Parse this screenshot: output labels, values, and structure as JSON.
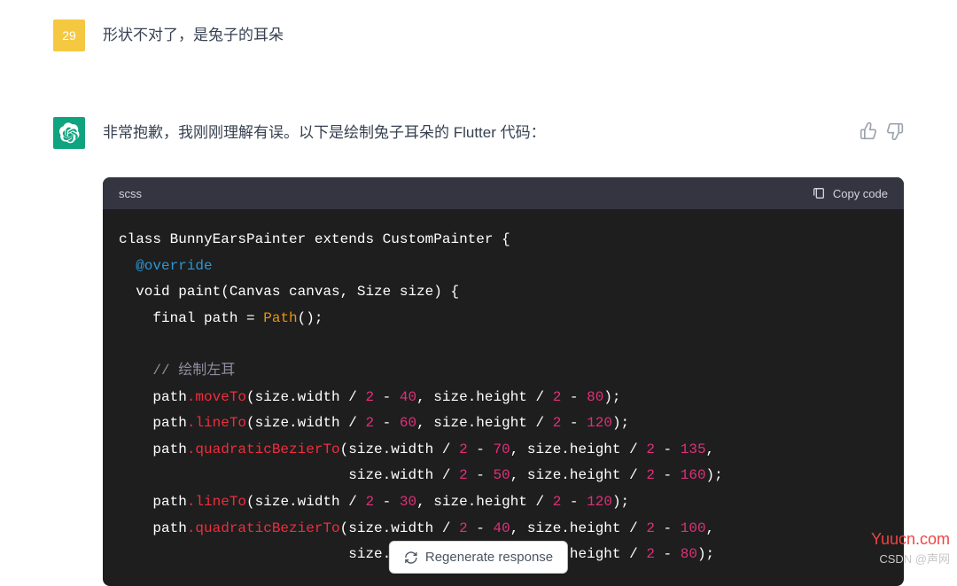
{
  "user": {
    "avatar_text": "29",
    "message": "形状不对了，是兔子的耳朵"
  },
  "assistant": {
    "message": "非常抱歉，我刚刚理解有误。以下是绘制兔子耳朵的 Flutter 代码："
  },
  "code": {
    "language": "scss",
    "copy_label": "Copy code",
    "lines": {
      "l1a": "class BunnyEarsPainter extends CustomPainter {",
      "l2a": "@override",
      "l3a": "void paint(Canvas canvas, Size size) {",
      "l4a": "final path = ",
      "l4b": "Path",
      "l4c": "();",
      "l5a": "// 绘制左耳",
      "l6a": "path",
      "l6b": ".moveTo",
      "l6c": "(size.width / ",
      "l6d": "2",
      "l6e": " - ",
      "l6f": "40",
      "l6g": ", size.height / ",
      "l6h": "2",
      "l6i": " - ",
      "l6j": "80",
      "l6k": ");",
      "l7b": ".lineTo",
      "l7f": "60",
      "l7j": "120",
      "l8b": ".quadraticBezierTo",
      "l8f": "70",
      "l8j": "135",
      "l9f": "50",
      "l9j": "160",
      "l10f": "30",
      "l11f": "40",
      "l11j": "100",
      "l12pre": "                        ",
      "l12j": "80"
    }
  },
  "regenerate_label": "Regenerate response",
  "watermarks": {
    "brand": "Yuucn.com",
    "csdn": "CSDN @声网"
  }
}
